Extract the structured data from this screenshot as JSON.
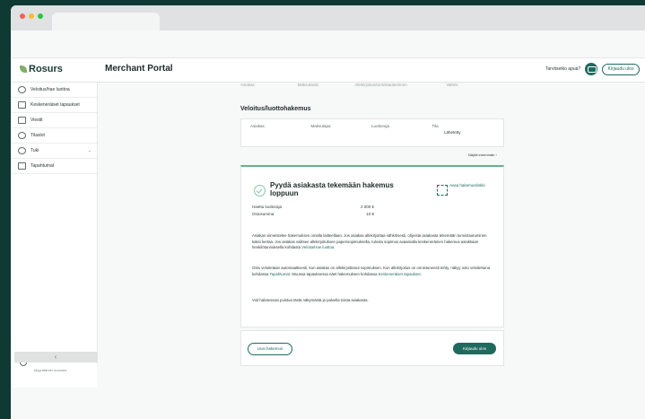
{
  "colors": {
    "accent": "#1f6a5e",
    "success": "#68b08d",
    "background": "#0f3a33"
  },
  "header": {
    "logo": "Rosurs",
    "title": "Merchant Portal",
    "help_text": "Tarvitsetko apua?",
    "logout": "Kirjaudu ulos"
  },
  "sidebar": {
    "items": [
      {
        "label": "Veloitus/hae luottoa",
        "icon": "credit-card-icon"
      },
      {
        "label": "Keskeneräiset tapaukset",
        "icon": "list-icon"
      },
      {
        "label": "Viestit",
        "icon": "mail-icon"
      },
      {
        "label": "Tilastot",
        "icon": "chart-icon"
      },
      {
        "label": "Tuki",
        "icon": "support-icon"
      },
      {
        "label": "Tapahtumat",
        "icon": "events-icon"
      }
    ],
    "user_name": "Myyntitiimin nuomes"
  },
  "faded_header": [
    "Asiakas",
    "Maksutavat",
    "Allekirjoitus/tunnistautuminen",
    "Valmis"
  ],
  "section_title": "Veloitus/luottohakemus",
  "table": {
    "columns": [
      "Asiakas",
      "Maksutapa",
      "Luottoraja",
      "Tila"
    ],
    "status_value": "Lähetetty",
    "more_link": "Näytä enemmän ›"
  },
  "panel": {
    "title": "Pyydä asiakasta tekemään hakemus loppuun",
    "qr_label": "Avaa hakemuslinkki",
    "rows": [
      {
        "label": "Haettu luottoraja",
        "value": "2 000 €"
      },
      {
        "label": "Ostosumma",
        "value": "10 €"
      }
    ],
    "p1": "Asiakas viimeistelee hakemuksen omalla laitteellaan. Jos asiakas allekirjoittaa sähköisesti, ohjeista asiakasta tekemään tunnistautuminen kaksi kertaa. Jos asiakas valitsee allekirjoituksen paperisopimuksella, tulosta sopimus avaamalla keskeneräinen hakemus asiakkaan henkilötunnuksella kohdasta",
    "p1_link": "Veloita/Hae luottoa.",
    "p2_start": "Osto veloitetaan automaattisesti, kun asiakas on allekirjoittanut sopimuksen. Kun allekirjoitus on onnistuneesti tehty, näkyy osto veloitettuna kohdassa",
    "p2_link1": "Tapahtumat",
    "p2_mid": ". Muussa tapauksessa näet hakemuksen kohdassa",
    "p2_link2": "Keskeneräiset tapaukset.",
    "p3": "Voit halutessasi poistua tästä näkymästä ja palvella toista asiakasta."
  },
  "footer": {
    "new_application": "Uusi hakemus",
    "logout": "Kirjaudu ulos"
  }
}
